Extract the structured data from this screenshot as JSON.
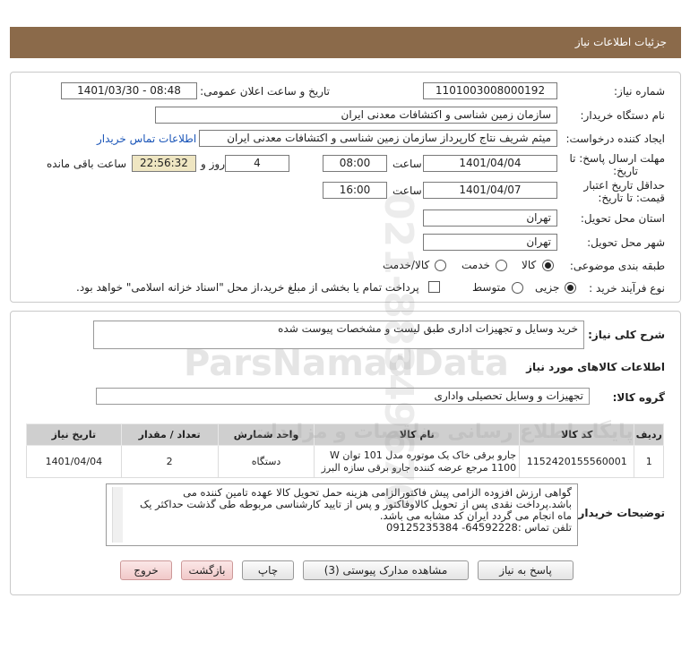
{
  "header": {
    "title": "جزئیات اطلاعات نیاز"
  },
  "form": {
    "need_number_label": "شماره نیاز:",
    "need_number": "1101003008000192",
    "announce_label": "تاریخ و ساعت اعلان عمومی:",
    "announce_value": "1401/03/30 - 08:48",
    "buyer_org_label": "نام دستگاه خریدار:",
    "buyer_org": "سازمان زمین شناسی و اکتشافات معدنی ایران",
    "creator_label": "ایجاد کننده درخواست:",
    "creator": "میثم شریف نتاج کارپرداز سازمان زمین شناسی و اکتشافات معدنی ایران",
    "contact_link": "اطلاعات تماس خریدار",
    "deadline_label_1": "مهلت ارسال پاسخ: تا",
    "deadline_label_2": "تاریخ:",
    "deadline_date": "1401/04/04",
    "time_label": "ساعت",
    "deadline_time": "08:00",
    "days_value": "4",
    "days_label": "روز و",
    "remaining_time": "22:56:32",
    "remaining_label": "ساعت باقی مانده",
    "validity_label_1": "حداقل تاریخ اعتبار",
    "validity_label_2": "قیمت: تا تاریخ:",
    "validity_date": "1401/04/07",
    "validity_time_label": "ساعت",
    "validity_time": "16:00",
    "province_label": "استان محل تحویل:",
    "province": "تهران",
    "city_label": "شهر محل تحویل:",
    "city": "تهران",
    "category_label": "طبقه بندی موضوعی:",
    "category_options": [
      "کالا",
      "خدمت",
      "کالا/خدمت"
    ],
    "process_label": "نوع فرآیند خرید :",
    "process_options": [
      "جزیی",
      "متوسط"
    ],
    "payment_note": "پرداخت تمام یا بخشی از مبلغ خرید،از محل \"اسناد خزانه اسلامی\" خواهد بود."
  },
  "summary": {
    "label": "شرح کلی نیاز:",
    "value": "خرید وسایل و تجهیزات اداری طبق لیست و مشخصات پیوست شده"
  },
  "goods": {
    "section_title": "اطلاعات کالاهای مورد نیاز",
    "group_label": "گروه کالا:",
    "group_value": "تجهیزات و وسایل تحصیلی واداری",
    "table": {
      "headers": [
        "ردیف",
        "کد کالا",
        "نام کالا",
        "واحد شمارش",
        "تعداد / مقدار",
        "تاریخ نیاز"
      ],
      "rows": [
        {
          "row": "1",
          "code": "1152420155560001",
          "name": "جارو برقی خاک یک موتوره مدل 101 توان W 1100 مرجع عرضه کننده جارو برقی سازه البرز",
          "unit": "دستگاه",
          "qty": "2",
          "date": "1401/04/04"
        }
      ]
    }
  },
  "buyer_notes": {
    "label": "توضیحات خریدار:",
    "text": "گواهی ارزش افزوده الزامی پیش فاکتورالزامی هزینه حمل تحویل کالا عهده تامین کننده می باشد.پرداخت نقدی پس از تحویل کالاوفاکتور و پس از تایید کارشناسی مربوطه طی گذشت حداکثر یک ماه انجام می گردد ایران کد مشابه می باشد.",
    "phone": "تلفن تماس :64592228- 09125235384"
  },
  "buttons": {
    "reply": "پاسخ به نیاز",
    "attachments": "مشاهده مدارک پیوستی (3)",
    "print": "چاپ",
    "back": "بازگشت",
    "exit": "خروج"
  },
  "watermark": {
    "brand": "ParsNamadData",
    "phone": "021-88349670",
    "persian": "پایگاه اطلاع رسانی مناقصات و مزایدات"
  }
}
